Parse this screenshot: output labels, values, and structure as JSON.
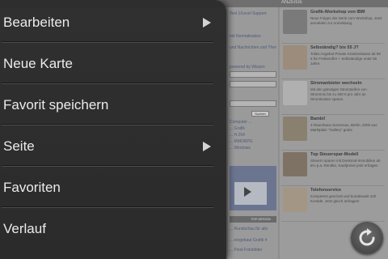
{
  "menu": {
    "items": [
      {
        "label": "Bearbeiten",
        "has_submenu": true
      },
      {
        "label": "Neue Karte",
        "has_submenu": false
      },
      {
        "label": "Favorit speichern",
        "has_submenu": false
      },
      {
        "label": "Seite",
        "has_submenu": true
      },
      {
        "label": "Favoriten",
        "has_submenu": false
      },
      {
        "label": "Verlauf",
        "has_submenu": false
      }
    ]
  },
  "background_page": {
    "header_text": "ANZEIGE",
    "mid_column": {
      "lines": [
        "Test 1/Level Support",
        "mit Normalisation",
        "und Nachrichten und Themen, Gerüchte",
        "powered by Wissen",
        "Suchen",
        "Computer ...",
        "... Grafik",
        "... H.264",
        "... MMORPG",
        "... Palm/Pre",
        "... Windows",
        "TOP-DESIGN",
        "... Rundschau für alle",
        "... eingebaut Grafik 4",
        "... Pixel-Fotobilder"
      ],
      "search_button": "Suchen"
    },
    "news": [
      {
        "title": "Grafik-Workshop von IBM",
        "desc": "Neue Folgen der Serie zum Workshop. Jetzt anmelden zur Anmeldung."
      },
      {
        "title": "Selbständig? bis 55 J?",
        "desc": "Tolles Angebot Private Krankenkasse ab 99 € für Freiberufler + Selbständige unter 55 Jahre."
      },
      {
        "title": "Stromanbieter wechseln",
        "desc": "Mit den günstigen Stromtarifen von Strommix bis zu 400 € pro Jahr an Stromkosten sparen."
      },
      {
        "title": "Bambi!",
        "desc": "4-Raumhaus Sonnenau, Berlin, 2009 aus Marktplatz \"Gallery\" gratis"
      },
      {
        "title": "Top Steuerspar-Modell",
        "desc": "Steuern sparen mit Denkmal-Immobilien ab 6% p.a. Rendite, Kaufpreise jetzt erfragen"
      },
      {
        "title": "Telefonservice",
        "desc": "Kompetent geschult und bundesweit 24h Kontakt. Jetzt gleich anfragen!"
      }
    ]
  },
  "colors": {
    "menu_bg": "#2b2b2b",
    "menu_text": "#f2f2f2",
    "page_dim": "#8e8e8e"
  },
  "icons": {
    "submenu": "chevron-right-icon",
    "reload": "reload-icon"
  }
}
